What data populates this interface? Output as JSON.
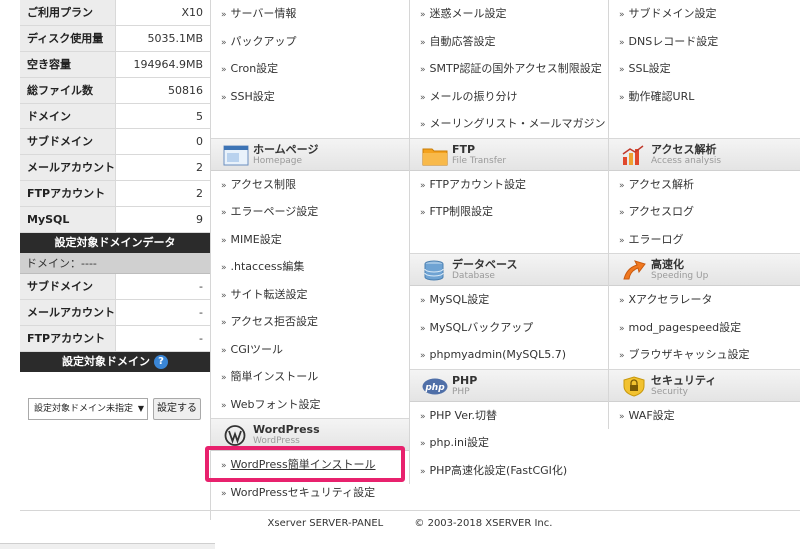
{
  "stats": [
    {
      "label": "ご利用プラン",
      "value": "X10"
    },
    {
      "label": "ディスク使用量",
      "value": "5035.1MB"
    },
    {
      "label": "空き容量",
      "value": "194964.9MB"
    },
    {
      "label": "総ファイル数",
      "value": "50816"
    },
    {
      "label": "ドメイン",
      "value": "5"
    },
    {
      "label": "サブドメイン",
      "value": "0"
    },
    {
      "label": "メールアカウント",
      "value": "2"
    },
    {
      "label": "FTPアカウント",
      "value": "2"
    },
    {
      "label": "MySQL",
      "value": "9"
    }
  ],
  "domain_data": {
    "heading": "設定対象ドメインデータ",
    "domain_line": "ドメイン：----",
    "rows": [
      {
        "label": "サブドメイン",
        "value": "-"
      },
      {
        "label": "メールアカウント",
        "value": "-"
      },
      {
        "label": "FTPアカウント",
        "value": "-"
      }
    ]
  },
  "domain_select": {
    "heading": "設定対象ドメイン",
    "help": "?",
    "selected": "設定対象ドメイン未指定",
    "arrow": "▼",
    "button": "設定する"
  },
  "bullet": "»",
  "col1": {
    "top_items": [
      "サーバー情報",
      "パックアップ",
      "Cron設定",
      "SSH設定"
    ],
    "homepage": {
      "title": "ホームページ",
      "subtitle": "Homepage"
    },
    "homepage_items": [
      "アクセス制限",
      "エラーページ設定",
      "MIME設定",
      ".htaccess編集",
      "サイト転送設定",
      "アクセス拒否設定",
      "CGIツール",
      "簡単インストール",
      "Webフォント設定"
    ],
    "wordpress": {
      "title": "WordPress",
      "subtitle": "WordPress"
    },
    "wordpress_items": [
      "WordPress簡単インストール",
      "WordPressセキュリティ設定"
    ]
  },
  "col2": {
    "top_items": [
      "迷惑メール設定",
      "自動応答設定",
      "SMTP認証の国外アクセス制限設定",
      "メールの振り分け",
      "メーリングリスト・メールマガジン"
    ],
    "ftp": {
      "title": "FTP",
      "subtitle": "File Transfer"
    },
    "ftp_items": [
      "FTPアカウント設定",
      "FTP制限設定"
    ],
    "database": {
      "title": "データベース",
      "subtitle": "Database"
    },
    "database_items": [
      "MySQL設定",
      "MySQLバックアップ",
      "phpmyadmin(MySQL5.7)"
    ],
    "php": {
      "title": "PHP",
      "subtitle": "PHP",
      "icon_text": "php"
    },
    "php_items": [
      "PHP Ver.切替",
      "php.ini設定",
      "PHP高速化設定(FastCGI化)"
    ]
  },
  "col3": {
    "top_items": [
      "サブドメイン設定",
      "DNSレコード設定",
      "SSL設定",
      "動作確認URL"
    ],
    "access": {
      "title": "アクセス解析",
      "subtitle": "Access analysis"
    },
    "access_items": [
      "アクセス解析",
      "アクセスログ",
      "エラーログ"
    ],
    "speed": {
      "title": "高速化",
      "subtitle": "Speeding Up"
    },
    "speed_items": [
      "Xアクセラレータ",
      "mod_pagespeed設定",
      "ブラウザキャッシュ設定"
    ],
    "security": {
      "title": "セキュリティ",
      "subtitle": "Security"
    },
    "security_items": [
      "WAF設定"
    ]
  },
  "footer": {
    "brand": "Xserver SERVER-PANEL",
    "copyright": "© 2003-2018 XSERVER Inc."
  },
  "colors": {
    "highlight": "#e8216d",
    "dark_header": "#2b2b2b",
    "help_icon": "#3a86d6"
  }
}
